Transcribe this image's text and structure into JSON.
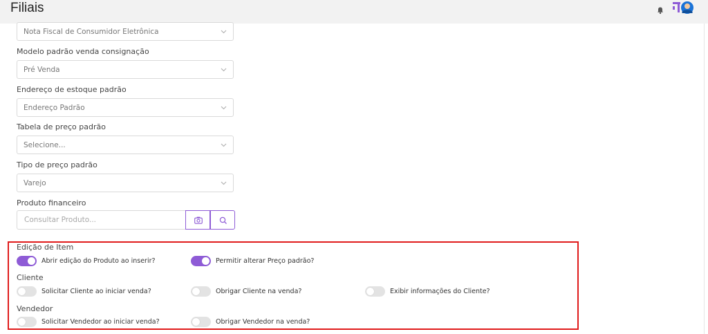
{
  "header": {
    "title": "Filiais"
  },
  "fields": [
    {
      "label": "",
      "value": "Nota Fiscal de Consumidor Eletrônica"
    },
    {
      "label": "Modelo padrão venda consignação",
      "value": "Pré Venda"
    },
    {
      "label": "Endereço de estoque padrão",
      "value": "Endereço Padrão"
    },
    {
      "label": "Tabela de preço padrão",
      "value": "Selecione..."
    },
    {
      "label": "Tipo de preço padrão",
      "value": "Varejo"
    }
  ],
  "produto": {
    "label": "Produto financeiro",
    "placeholder": "Consultar Produto..."
  },
  "sections": {
    "edicao": {
      "title": "Edição de Item",
      "toggles": [
        {
          "label": "Abrir edição do Produto ao inserir?",
          "on": true
        },
        {
          "label": "Permitir alterar Preço padrão?",
          "on": true
        }
      ]
    },
    "cliente": {
      "title": "Cliente",
      "toggles": [
        {
          "label": "Solicitar Cliente ao iniciar venda?",
          "on": false
        },
        {
          "label": "Obrigar Cliente na venda?",
          "on": false
        },
        {
          "label": "Exibir informações do Cliente?",
          "on": false
        }
      ]
    },
    "vendedor": {
      "title": "Vendedor",
      "toggles": [
        {
          "label": "Solicitar Vendedor ao iniciar venda?",
          "on": false
        },
        {
          "label": "Obrigar Vendedor na venda?",
          "on": false
        }
      ]
    }
  },
  "colors": {
    "accent": "#8e5bd6",
    "highlight": "#e01a1a"
  },
  "icons": [
    "bell-icon",
    "app-logo",
    "avatar",
    "chevron-down-icon",
    "camera-icon",
    "search-icon"
  ]
}
